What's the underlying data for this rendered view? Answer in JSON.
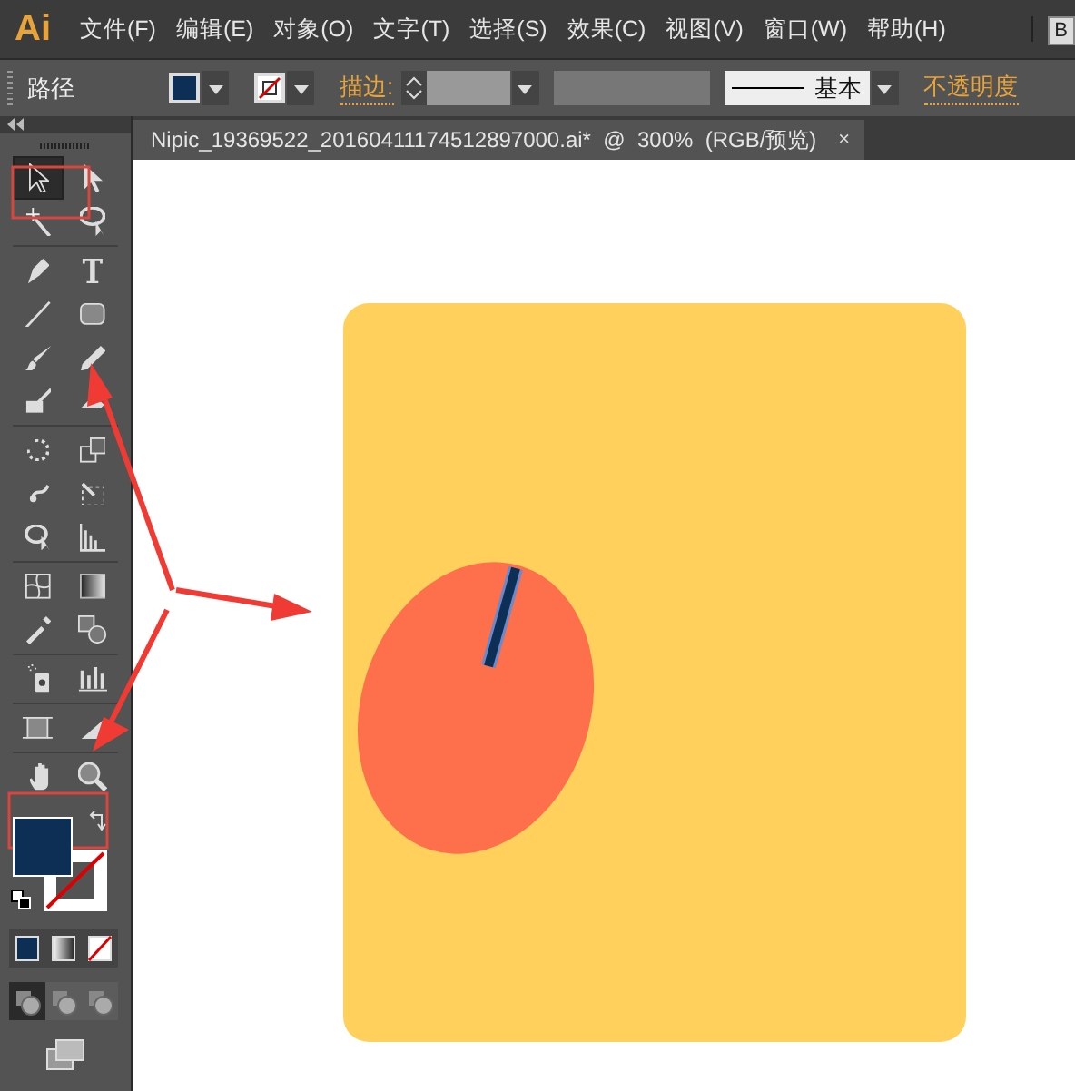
{
  "app": {
    "logo": "Ai",
    "workspace_button": "B"
  },
  "menu": [
    "文件(F)",
    "编辑(E)",
    "对象(O)",
    "文字(T)",
    "选择(S)",
    "效果(C)",
    "视图(V)",
    "窗口(W)",
    "帮助(H)"
  ],
  "control_bar": {
    "selection": "路径",
    "stroke_label": "描边:",
    "style": "基本",
    "opacity_label": "不透明度"
  },
  "document_tab": {
    "title": "Nipic_19369522_20160411174512897000.ai*  @  300%  (RGB/预览)",
    "close": "×"
  },
  "tools": [
    {
      "selected": true
    },
    {
      "selected": false
    },
    {
      "selected": false
    },
    {
      "selected": false
    },
    {
      "selected": false
    },
    {
      "selected": false
    },
    {
      "selected": false
    },
    {
      "selected": false
    },
    {
      "selected": false
    },
    {
      "selected": false
    },
    {
      "selected": false
    },
    {
      "selected": false
    },
    {
      "selected": false
    },
    {
      "selected": false
    },
    {
      "selected": false
    },
    {
      "selected": false
    },
    {
      "selected": false
    },
    {
      "selected": false
    },
    {
      "selected": false
    },
    {
      "selected": false
    },
    {
      "selected": false
    },
    {
      "selected": false
    },
    {
      "selected": false
    },
    {
      "selected": false
    },
    {
      "selected": false
    },
    {
      "selected": false
    },
    {
      "selected": false
    },
    {
      "selected": false
    }
  ],
  "fill": {
    "color": "#0d2f55"
  },
  "stroke": {
    "kind": "none"
  },
  "draw_modes": [
    {
      "selected": true
    },
    {
      "selected": false
    },
    {
      "selected": false
    }
  ]
}
